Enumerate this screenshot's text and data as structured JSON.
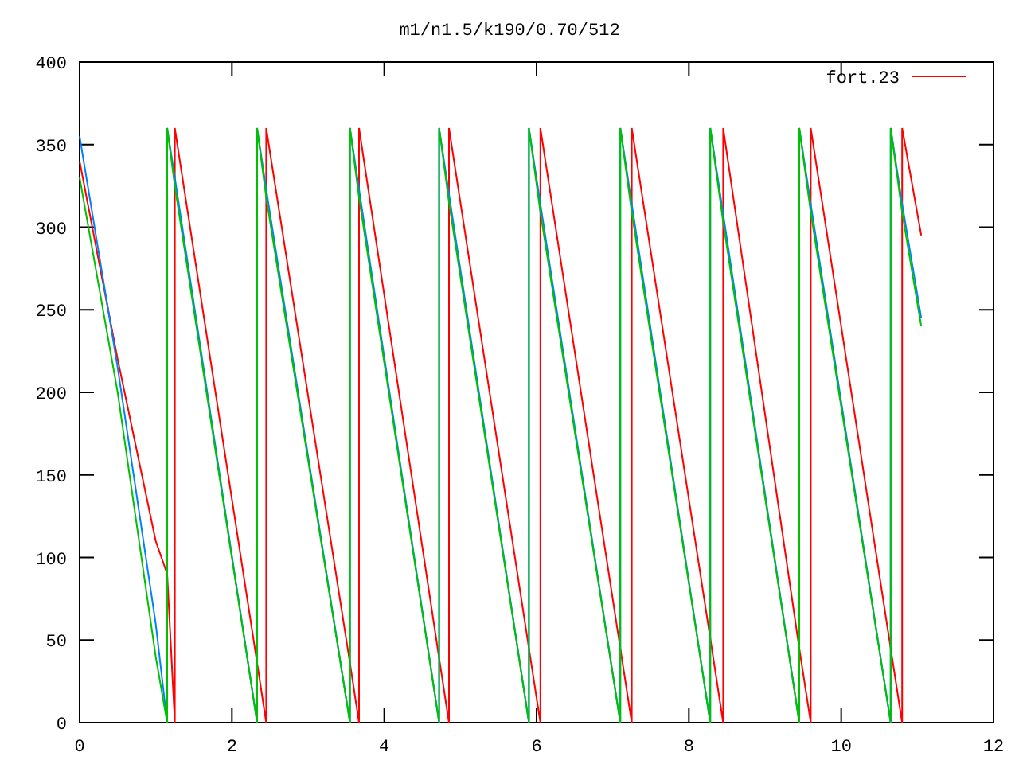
{
  "chart": {
    "chart_data": {
      "type": "line",
      "title": "m1/n1.5/k190/0.70/512",
      "x": [
        0,
        0.5,
        1.0,
        1.15,
        1.15,
        1.25,
        1.25,
        2.33,
        2.33,
        2.45,
        2.45,
        3.55,
        3.55,
        3.67,
        3.67,
        4.72,
        4.72,
        4.85,
        4.85,
        5.9,
        5.9,
        6.05,
        6.05,
        7.1,
        7.1,
        7.25,
        7.25,
        8.28,
        8.28,
        8.45,
        8.45,
        9.45,
        9.45,
        9.6,
        9.6,
        10.65,
        10.65,
        10.8,
        10.8,
        11.05
      ],
      "series": [
        {
          "name": "fort.23",
          "color": "#ff0000",
          "values": [
            340,
            220,
            110,
            90,
            90,
            0,
            360,
            36,
            36,
            0,
            360,
            36,
            36,
            0,
            360,
            39,
            39,
            0,
            360,
            45,
            45,
            0,
            360,
            45,
            45,
            0,
            360,
            51,
            51,
            0,
            360,
            45,
            45,
            0,
            360,
            45,
            45,
            0,
            360,
            295
          ]
        },
        {
          "color": "#0080ff",
          "values": [
            355,
            215,
            60,
            0,
            360,
            330,
            330,
            0,
            360,
            323,
            323,
            0,
            360,
            323,
            323,
            0,
            360,
            320,
            320,
            0,
            360,
            314,
            314,
            0,
            360,
            314,
            314,
            0,
            360,
            308,
            308,
            0,
            360,
            314,
            314,
            0,
            360,
            314,
            314,
            245
          ]
        },
        {
          "color": "#00c000",
          "values": [
            330,
            200,
            40,
            0,
            360,
            325,
            325,
            0,
            360,
            318,
            318,
            0,
            360,
            318,
            318,
            0,
            360,
            315,
            315,
            0,
            360,
            309,
            309,
            0,
            360,
            309,
            309,
            0,
            360,
            303,
            303,
            0,
            360,
            309,
            309,
            0,
            360,
            309,
            309,
            240
          ]
        }
      ],
      "xlim": [
        0,
        12
      ],
      "ylim": [
        0,
        400
      ],
      "xticks": [
        0,
        2,
        4,
        6,
        8,
        10,
        12
      ],
      "yticks": [
        0,
        50,
        100,
        150,
        200,
        250,
        300,
        350,
        400
      ]
    }
  }
}
